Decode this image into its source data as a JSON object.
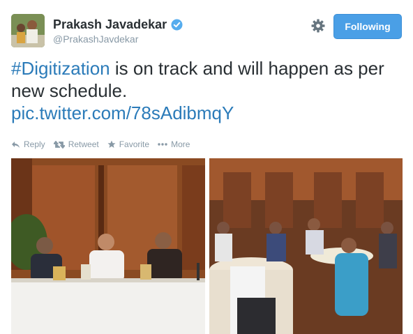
{
  "user": {
    "display_name": "Prakash Javadekar",
    "handle": "@PrakashJavdekar",
    "verified": true
  },
  "follow_button": {
    "label": "Following",
    "color": "#4a9fe6"
  },
  "tweet": {
    "hashtag": "#Digitization",
    "text": " is on track and will happen as per new schedule.",
    "link": "pic.twitter.com/78sAdibmqY"
  },
  "actions": {
    "reply": "Reply",
    "retweet": "Retweet",
    "favorite": "Favorite",
    "more": "More"
  },
  "colors": {
    "link": "#2b7bb9",
    "muted": "#8899a6",
    "text": "#292f33"
  },
  "icons": [
    "verified-badge-icon",
    "gear-icon",
    "reply-icon",
    "retweet-icon",
    "favorite-star-icon",
    "more-dots-icon"
  ]
}
